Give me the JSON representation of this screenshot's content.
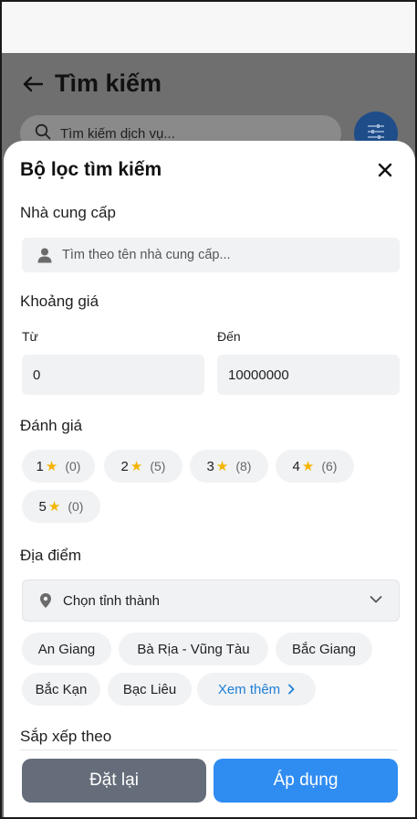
{
  "background": {
    "title": "Tìm kiếm",
    "search_placeholder": "Tìm kiếm dịch vụ..."
  },
  "sheet": {
    "title": "Bộ lọc tìm kiếm",
    "provider": {
      "label": "Nhà cung cấp",
      "placeholder": "Tìm theo tên nhà cung cấp..."
    },
    "price": {
      "label": "Khoảng giá",
      "from_label": "Từ",
      "from_value": "0",
      "to_label": "Đến",
      "to_value": "10000000"
    },
    "rating": {
      "label": "Đánh giá",
      "options": [
        {
          "stars": "1",
          "count": "(0)"
        },
        {
          "stars": "2",
          "count": "(5)"
        },
        {
          "stars": "3",
          "count": "(8)"
        },
        {
          "stars": "4",
          "count": "(6)"
        },
        {
          "stars": "5",
          "count": "(0)"
        }
      ]
    },
    "location": {
      "label": "Địa điểm",
      "select_placeholder": "Chọn tỉnh thành",
      "chips": [
        "An Giang",
        "Bà Rịa - Vũng Tàu",
        "Bắc Giang",
        "Bắc Kạn",
        "Bạc Liêu"
      ],
      "more_label": "Xem thêm"
    },
    "sort": {
      "label": "Sắp xếp theo"
    },
    "actions": {
      "reset_label": "Đặt lại",
      "apply_label": "Áp dụng"
    }
  },
  "colors": {
    "primary": "#2f8cf1",
    "reset": "#646d79",
    "star": "#f5b400",
    "link": "#1f7fd6"
  }
}
